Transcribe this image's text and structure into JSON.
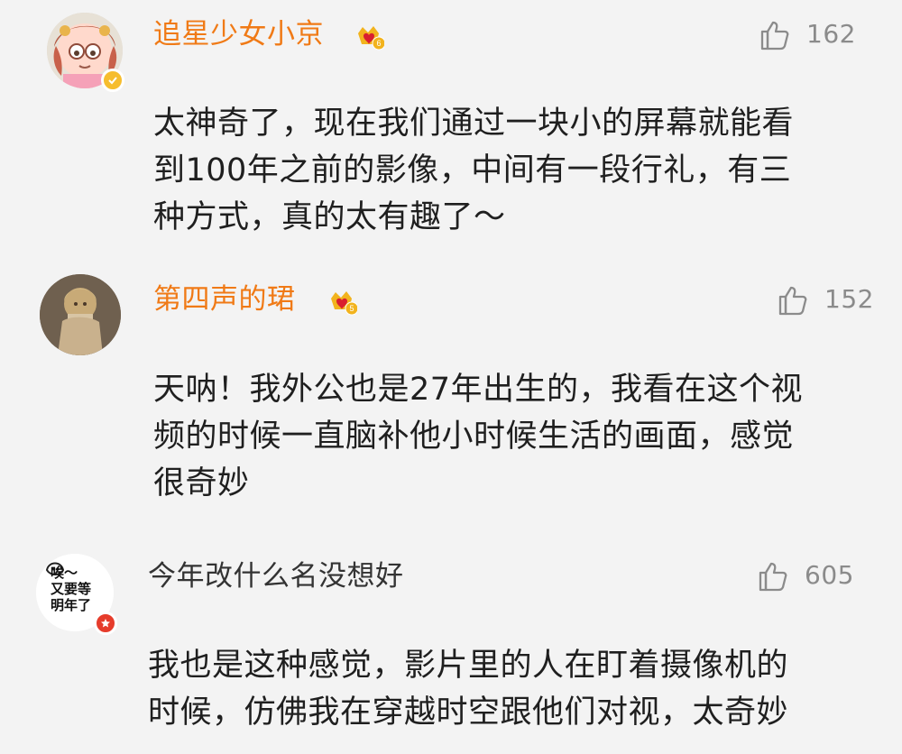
{
  "comments": [
    {
      "username": "追星少女小京",
      "likes": "162",
      "text": "太神奇了，现在我们通过一块小的屏幕就能看\n到100年之前的影像，中间有一段行礼，有三\n种方式，真的太有趣了～"
    },
    {
      "username": "第四声的珺",
      "likes": "152",
      "text": "天呐！我外公也是27年出生的，我看在这个视\n频的时候一直脑补他小时候生活的画面，感觉\n很奇妙"
    },
    {
      "username": "今年改什么名没想好",
      "likes": "605",
      "avatar_text": "唉～\n又要等\n明年了",
      "text": "我也是这种感觉，影片里的人在盯着摄像机的\n时候，仿佛我在穿越时空跟他们对视，太奇妙"
    }
  ],
  "icons": {
    "like": "thumbs-up-icon",
    "vip": "crown-vip-icon",
    "verify": "verified-badge-icon"
  },
  "colors": {
    "vip_username": "#f07a16",
    "normal_username": "#333333",
    "meta": "#8b8b8b",
    "background": "#f3f3f3",
    "vip_badge": "#f6bd2e",
    "red_badge": "#e63c2b"
  }
}
